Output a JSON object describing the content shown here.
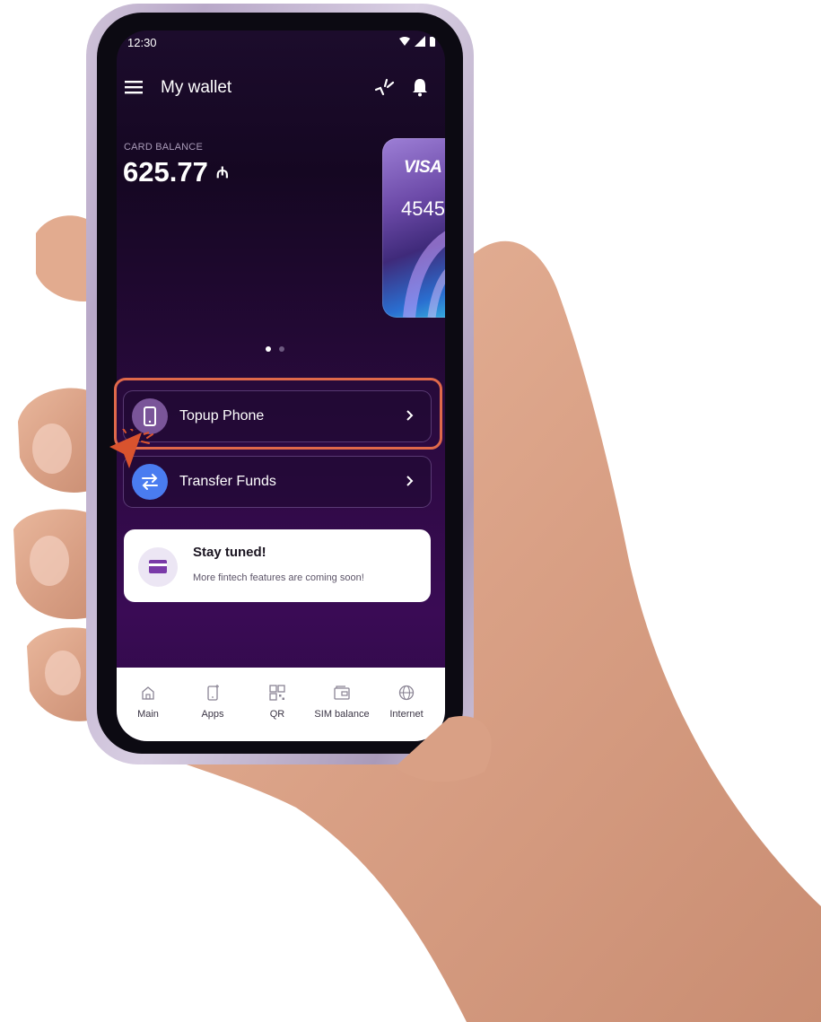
{
  "status_bar": {
    "time": "12:30"
  },
  "header": {
    "title": "My wallet",
    "menu_icon": "menu-icon",
    "sparkle_icon": "sparkle-icon",
    "bell_icon": "bell-icon"
  },
  "balance": {
    "label": "CARD BALANCE",
    "amount": "625.77",
    "currency_symbol": "₼"
  },
  "card": {
    "brand": "VISA",
    "number_partial": "4545"
  },
  "pager": {
    "pages": 2,
    "active_page": 1
  },
  "actions": [
    {
      "label": "Topup Phone",
      "icon": "phone-icon",
      "icon_bg": "#7a5599"
    },
    {
      "label": "Transfer Funds",
      "icon": "transfer-icon",
      "icon_bg": "#4a7cf0"
    }
  ],
  "notice": {
    "title": "Stay tuned!",
    "body": "More fintech features are coming soon!",
    "icon": "card-icon"
  },
  "bottom_nav": [
    {
      "label": "Main",
      "icon": "home-icon"
    },
    {
      "label": "Apps",
      "icon": "apps-icon"
    },
    {
      "label": "QR",
      "icon": "qr-icon"
    },
    {
      "label": "SIM balance",
      "icon": "sim-wallet-icon"
    },
    {
      "label": "Internet",
      "icon": "globe-icon"
    }
  ],
  "colors": {
    "highlight": "#e0694a",
    "screen_bg": "#1c0c2c",
    "accent_purple": "#7a5599",
    "accent_blue": "#4a7cf0"
  }
}
